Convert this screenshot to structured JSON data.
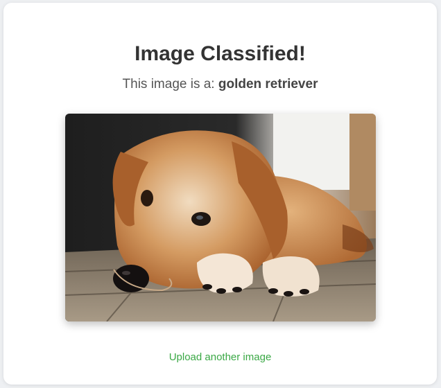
{
  "page": {
    "title": "Image Classified!",
    "result_prefix": "This image is a:",
    "result_label": "golden retriever",
    "upload_link_label": "Upload another image"
  },
  "image": {
    "subject": "golden retriever puppy lying on wooden floor"
  },
  "colors": {
    "link": "#3aa845",
    "title": "#333333",
    "text": "#555555"
  }
}
